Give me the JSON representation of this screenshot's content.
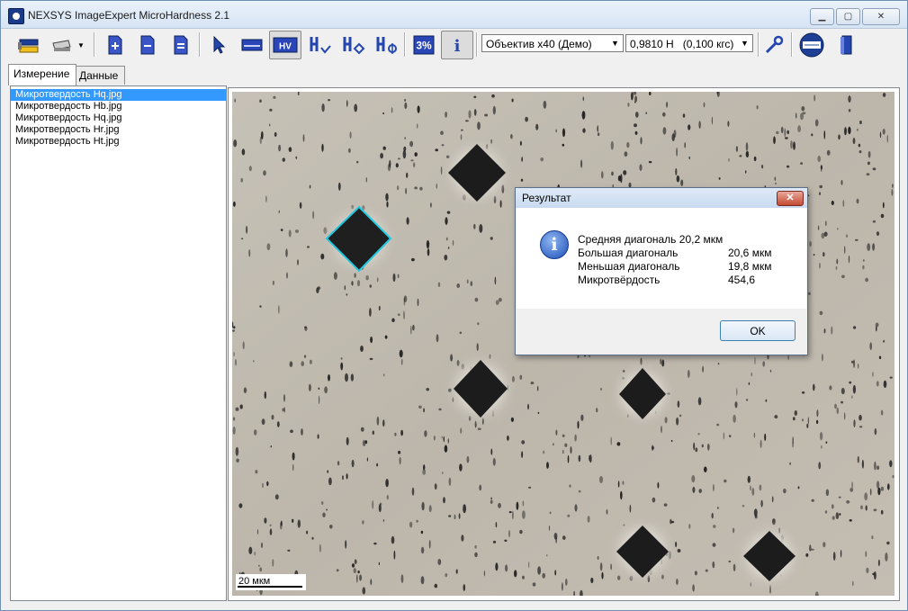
{
  "window": {
    "title": "NEXSYS ImageExpert MicroHardness 2.1"
  },
  "toolbar": {
    "objective_select": "Объектив x40 (Демо)",
    "load_select": "0,9810 Н   (0,100 кгс)",
    "percent_label": "3%",
    "info_label": "i",
    "hv_label": "HV"
  },
  "tabs": [
    {
      "label": "Измерение",
      "active": true
    },
    {
      "label": "Данные",
      "active": false
    }
  ],
  "files": [
    {
      "name": "Микротвердость Hq.jpg",
      "selected": true
    },
    {
      "name": "Микротвердость Hb.jpg",
      "selected": false
    },
    {
      "name": "Микротвердость Hq.jpg",
      "selected": false
    },
    {
      "name": "Микротвердость Hr.jpg",
      "selected": false
    },
    {
      "name": "Микротвердость Ht.jpg",
      "selected": false
    }
  ],
  "image": {
    "scale_label": "20 мкм"
  },
  "dialog": {
    "title": "Результат",
    "rows": [
      {
        "label": "Средняя диагональ  20,2 мкм",
        "value": ""
      },
      {
        "label": "Большая диагональ",
        "value": "20,6 мкм"
      },
      {
        "label": "Меньшая диагональ",
        "value": "19,8 мкм"
      },
      {
        "label": "Микротвёрдость",
        "value": "454,6"
      }
    ],
    "ok_label": "OK"
  },
  "colors": {
    "selection": "#3399ff",
    "measure_outline": "#22c7e0",
    "accent_icon": "#1b4fb8"
  }
}
